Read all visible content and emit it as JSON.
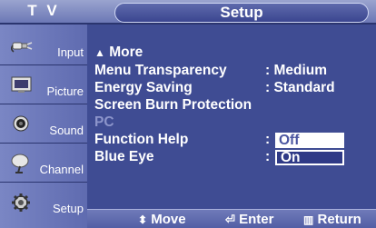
{
  "header": {
    "tv_label": "T V",
    "title": "Setup"
  },
  "sidebar": {
    "items": [
      {
        "label": "Input",
        "icon": "input-plug-icon"
      },
      {
        "label": "Picture",
        "icon": "picture-monitor-icon"
      },
      {
        "label": "Sound",
        "icon": "speaker-icon"
      },
      {
        "label": "Channel",
        "icon": "satellite-dish-icon"
      },
      {
        "label": "Setup",
        "icon": "gear-icon"
      }
    ]
  },
  "menu": {
    "more_label": "More",
    "items": [
      {
        "label": "Menu Transparency",
        "value": ": Medium"
      },
      {
        "label": "Energy Saving",
        "value": ": Standard"
      },
      {
        "label": "Screen Burn Protection",
        "value": ""
      },
      {
        "label": "PC",
        "value": ""
      },
      {
        "label": "Function Help",
        "value": ":"
      },
      {
        "label": "Blue Eye",
        "value": ":"
      }
    ],
    "options": {
      "off": "Off",
      "on": "On"
    }
  },
  "footer": {
    "move": "Move",
    "enter": "Enter",
    "return": "Return"
  },
  "colors": {
    "background": "#3f4c93",
    "selected_option_bg": "#ffffff",
    "dimmed_text": "#8d95cb"
  }
}
